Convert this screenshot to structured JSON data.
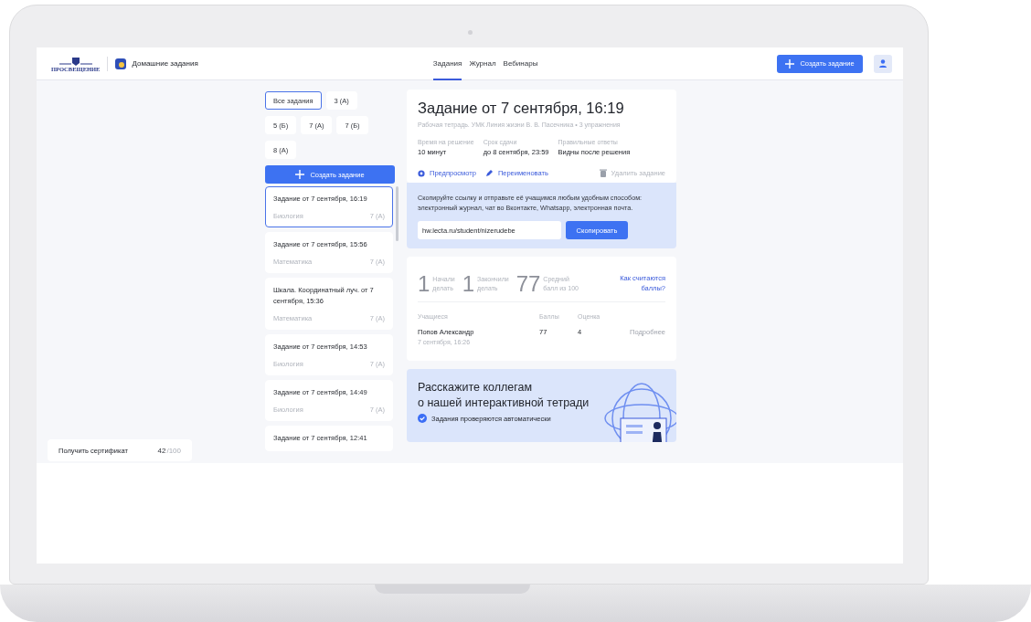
{
  "header": {
    "logo_text": "ПРОСВЕЩЕНИЕ",
    "app_title": "Домашние задания",
    "tabs": [
      {
        "label": "Задания",
        "selected": true
      },
      {
        "label": "Журнал",
        "selected": false
      },
      {
        "label": "Вебинары",
        "selected": false
      }
    ],
    "create_button": "Создать задание"
  },
  "certificate": {
    "label": "Получить сертификат",
    "score": "42",
    "total": "/100"
  },
  "filters": [
    {
      "label": "Все задания",
      "selected": true
    },
    {
      "label": "3 (А)",
      "selected": false
    },
    {
      "label": "5 (Б)",
      "selected": false
    },
    {
      "label": "7 (А)",
      "selected": false
    },
    {
      "label": "7 (Б)",
      "selected": false
    },
    {
      "label": "8 (А)",
      "selected": false
    }
  ],
  "create_button": "Создать задание",
  "assignments": [
    {
      "title": "Задание от 7 сентября, 16:19",
      "subject": "Биология",
      "class": "7 (А)",
      "selected": true
    },
    {
      "title": "Задание от 7 сентября, 15:56",
      "subject": "Математика",
      "class": "7 (А)",
      "selected": false
    },
    {
      "title": "Шкала. Координатный луч. от 7 сентября, 15:36",
      "subject": "Математика",
      "class": "7 (А)",
      "selected": false
    },
    {
      "title": "Задание от 7 сентября, 14:53",
      "subject": "Биология",
      "class": "7 (А)",
      "selected": false
    },
    {
      "title": "Задание от 7 сентября, 14:49",
      "subject": "Биология",
      "class": "7 (А)",
      "selected": false
    },
    {
      "title": "Задание от 7 сентября, 12:41",
      "selected": false
    }
  ],
  "detail": {
    "title": "Задание от 7 сентября, 16:19",
    "subtitle": "Рабочая тетрадь. УМК Линия жизни В. В. Пасечника • 3 упражнения",
    "info": [
      {
        "label": "Время на решение",
        "value": "10 минут"
      },
      {
        "label": "Срок сдачи",
        "value": "до 8 сентября, 23:59"
      },
      {
        "label": "Правильные ответы",
        "value": "Видны после решения"
      }
    ],
    "actions": [
      {
        "label": "Предпросмотр",
        "kind": "preview"
      },
      {
        "label": "Переименовать",
        "kind": "rename"
      },
      {
        "label": "Удалить задание",
        "kind": "delete"
      }
    ],
    "share": {
      "text": "Скопируйте ссылку и отправьте её учащимся любым удобным способом: электронный журнал, чат во Вконтакте, Whatsapp, электронная почта.",
      "link": "hw.lecta.ru/student/nizerudebe",
      "button": "Скопировать"
    },
    "stats": [
      {
        "value": "1",
        "label_lines": [
          "Начали",
          "делать"
        ]
      },
      {
        "value": "1",
        "label_lines": [
          "Закончили",
          "делать"
        ]
      },
      {
        "value": "77",
        "label_lines": [
          "Средний",
          "балл из 100"
        ]
      }
    ],
    "how_link": "Как считаются баллы?",
    "table": {
      "columns": [
        "Учащиеся",
        "Баллы",
        "Оценка"
      ],
      "rows": [
        {
          "name": "Попов Александр",
          "date": "7 сентября, 16:26",
          "score": "77",
          "grade": "4",
          "link": "Подробнее"
        }
      ]
    },
    "promo": {
      "title_lines": [
        "Расскажите коллегам",
        "о нашей интерактивной тетради"
      ],
      "points": [
        "Задания проверяются автоматически"
      ]
    }
  }
}
